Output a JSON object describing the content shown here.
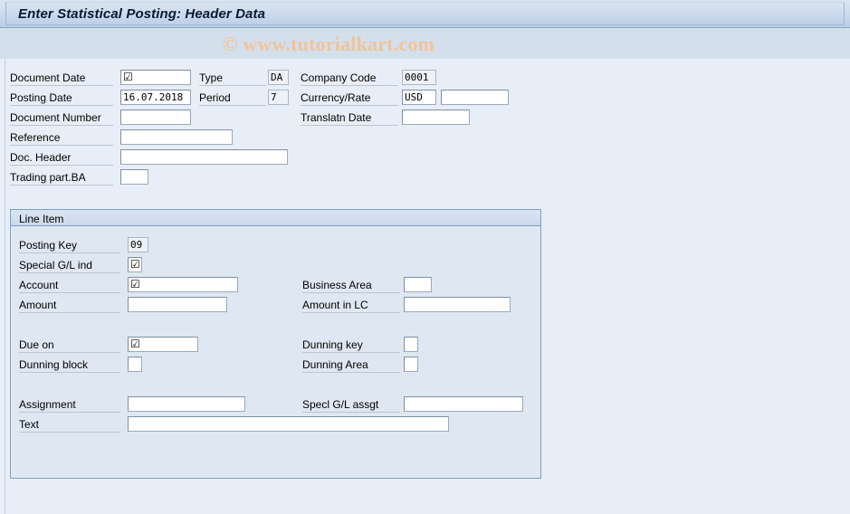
{
  "window": {
    "title": "Enter Statistical Posting: Header Data"
  },
  "watermark": {
    "text": "© www.tutorialkart.com"
  },
  "header_section": {
    "left_fields": [
      {
        "label": "Document Date",
        "value": "☑",
        "type": "checkglyph"
      },
      {
        "label": "Posting Date",
        "value": "16.07.2018",
        "type": "text"
      },
      {
        "label": "Document Number",
        "value": "",
        "type": "text"
      },
      {
        "label": "Reference",
        "value": "",
        "type": "text"
      },
      {
        "label": "Doc. Header",
        "value": "",
        "type": "text"
      },
      {
        "label": "Trading part.BA",
        "value": "",
        "type": "text"
      }
    ],
    "mid_fields": [
      {
        "label": "Type",
        "value": "DA"
      },
      {
        "label": "Period",
        "value": "7"
      }
    ],
    "right_fields": [
      {
        "label": "Company Code",
        "value": "0001"
      },
      {
        "label": "Currency/Rate",
        "value": "USD",
        "value2": ""
      },
      {
        "label": "Translatn Date",
        "value": ""
      }
    ]
  },
  "line_item": {
    "group_title": "Line Item",
    "left_fields": [
      {
        "label": "Posting Key",
        "value": "09",
        "type": "text"
      },
      {
        "label": "Special G/L ind",
        "value": "☑",
        "type": "checkglyph"
      },
      {
        "label": "Account",
        "value": "☑",
        "type": "checkglyph"
      },
      {
        "label": "Amount",
        "value": "",
        "type": "text"
      },
      {
        "label": "Due on",
        "value": "☑",
        "type": "checkglyph"
      },
      {
        "label": "Dunning block",
        "value": "",
        "type": "text"
      },
      {
        "label": "Assignment",
        "value": "",
        "type": "text"
      },
      {
        "label": "Text",
        "value": "",
        "type": "text"
      }
    ],
    "right_fields": [
      {
        "label": "Business Area",
        "value": ""
      },
      {
        "label": "Amount in LC",
        "value": ""
      },
      {
        "label": "Dunning key",
        "value": ""
      },
      {
        "label": "Dunning Area",
        "value": ""
      },
      {
        "label": "Specl G/L assgt",
        "value": ""
      }
    ]
  },
  "colors": {
    "page_background": "#e8eef7",
    "title_bar": "#b9cde4",
    "panel_border": "#7d9fc4",
    "watermark": "#f0c49a",
    "field_background": "#ffffff"
  }
}
